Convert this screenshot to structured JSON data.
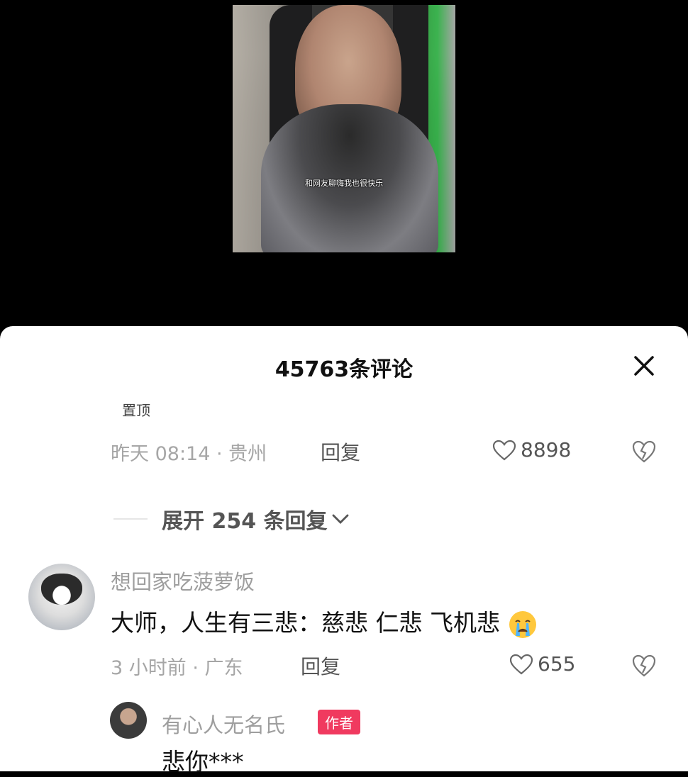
{
  "video": {
    "caption": "和网友聊嗨我也很快乐"
  },
  "sheet": {
    "title": "45763条评论",
    "pinned": {
      "label": "置顶",
      "meta": "昨天 08:14 · 贵州",
      "reply": "回复",
      "likes": "8898"
    },
    "expand_label": "展开 254 条回复",
    "comment1": {
      "username": "想回家吃菠萝饭",
      "text": "大师，人生有三悲：慈悲 仁悲  飞机悲",
      "emoji": "crying-face-icon",
      "meta": "3 小时前 · 广东",
      "reply": "回复",
      "likes": "655"
    },
    "reply1": {
      "username": "有心人无名氏",
      "badge": "作者",
      "text": "悲你***"
    }
  },
  "colors": {
    "badge": "#f03a5f",
    "meta": "#a6a6a6"
  }
}
